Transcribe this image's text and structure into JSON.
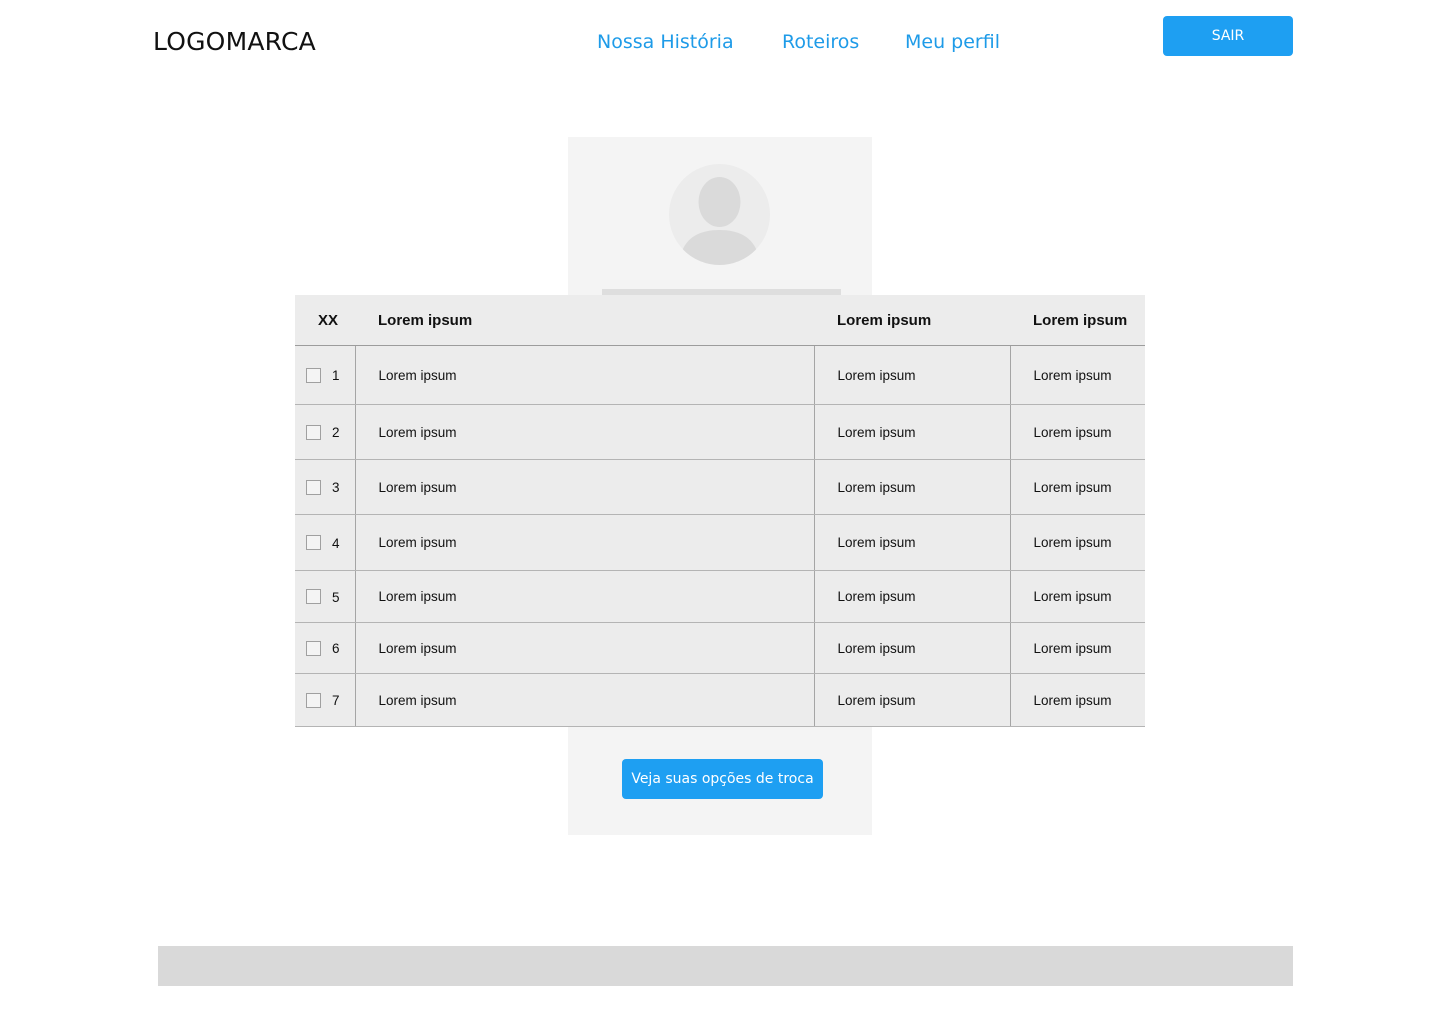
{
  "header": {
    "logo": "LOGOMARCA",
    "nav": [
      {
        "label": "Nossa História"
      },
      {
        "label": "Roteiros"
      },
      {
        "label": "Meu perfil"
      }
    ],
    "logout_label": "SAIR"
  },
  "profile": {
    "avatar_icon": "user-silhouette-icon"
  },
  "table": {
    "headers": [
      "XX",
      "Lorem ipsum",
      "Lorem ipsum",
      "Lorem ipsum"
    ],
    "rows": [
      {
        "num": "1",
        "c1": "Lorem ipsum",
        "c2": "Lorem ipsum",
        "c3": "Lorem ipsum"
      },
      {
        "num": "2",
        "c1": "Lorem ipsum",
        "c2": "Lorem ipsum",
        "c3": "Lorem ipsum"
      },
      {
        "num": "3",
        "c1": "Lorem ipsum",
        "c2": "Lorem ipsum",
        "c3": "Lorem ipsum"
      },
      {
        "num": "4",
        "c1": "Lorem ipsum",
        "c2": "Lorem ipsum",
        "c3": "Lorem ipsum"
      },
      {
        "num": "5",
        "c1": "Lorem ipsum",
        "c2": "Lorem ipsum",
        "c3": "Lorem ipsum"
      },
      {
        "num": "6",
        "c1": "Lorem ipsum",
        "c2": "Lorem ipsum",
        "c3": "Lorem ipsum"
      },
      {
        "num": "7",
        "c1": "Lorem ipsum",
        "c2": "Lorem ipsum",
        "c3": "Lorem ipsum"
      }
    ]
  },
  "action_button_label": "Veja suas opções de troca",
  "colors": {
    "accent": "#1e9ff2",
    "nav_link": "#1e9be8",
    "card_bg": "#f4f4f4",
    "table_bg": "#ececec",
    "footer_bg": "#d9d9d9"
  }
}
